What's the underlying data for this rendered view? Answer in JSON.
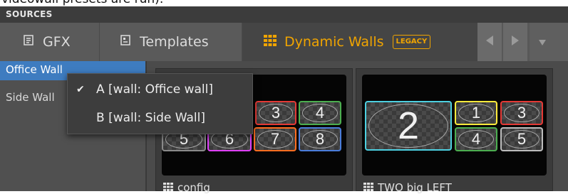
{
  "caption": "videowall presets are run):",
  "panel": {
    "title": "SOURCES",
    "tabs": [
      {
        "label": "GFX",
        "icon": "gfx-icon"
      },
      {
        "label": "Templates",
        "icon": "templates-icon"
      },
      {
        "label": "Dynamic Walls",
        "icon": "grid-icon",
        "badge": "LEGACY",
        "active": true
      }
    ],
    "accent_color": "#f0a400",
    "selection_color": "#3e7cc0"
  },
  "sidebar": {
    "items": [
      {
        "label": "Office Wall",
        "selected": true
      },
      {
        "label": "Side Wall",
        "selected": false
      }
    ]
  },
  "dropdown": {
    "items": [
      {
        "label": "A [wall: Office wall]",
        "checked": true
      },
      {
        "label": "B [wall: Side Wall]",
        "checked": false
      }
    ]
  },
  "cards": [
    {
      "label": "config",
      "cells": [
        "3",
        "4",
        "5",
        "6",
        "7",
        "8"
      ]
    },
    {
      "label": "TWO big LEFT",
      "cells": [
        "2",
        "1",
        "3",
        "4",
        "5"
      ]
    }
  ]
}
